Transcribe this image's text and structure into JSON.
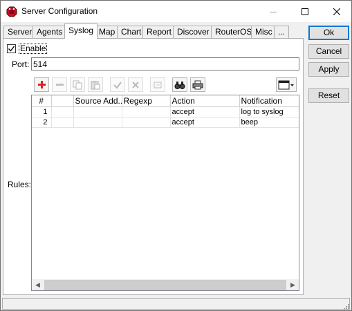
{
  "window": {
    "title": "Server Configuration"
  },
  "tabs": [
    "Server",
    "Agents",
    "Syslog",
    "Map",
    "Chart",
    "Report",
    "Discover",
    "RouterOS",
    "Misc",
    "..."
  ],
  "active_tab": "Syslog",
  "enable": {
    "label": "Enable",
    "checked": true
  },
  "port": {
    "label": "Port:",
    "value": "514"
  },
  "toolbar": {
    "icons": [
      "add-icon",
      "remove-icon",
      "copy-icon",
      "paste-icon",
      "enable-icon",
      "disable-icon",
      "comment-icon",
      "find-icon",
      "print-icon",
      "columns-icon"
    ]
  },
  "rules": {
    "label": "Rules:",
    "columns": [
      "#",
      "",
      "Source Add...",
      "Regexp",
      "Action",
      "Notification"
    ],
    "rows": [
      {
        "num": "1",
        "flag": "",
        "source": "",
        "regexp": "",
        "action": "accept",
        "notification": "log to syslog"
      },
      {
        "num": "2",
        "flag": "",
        "source": "",
        "regexp": "",
        "action": "accept",
        "notification": "beep"
      }
    ]
  },
  "buttons": {
    "ok": "Ok",
    "cancel": "Cancel",
    "apply": "Apply",
    "reset": "Reset"
  },
  "colors": {
    "add": "#e02020",
    "accent": "#0078d7"
  }
}
